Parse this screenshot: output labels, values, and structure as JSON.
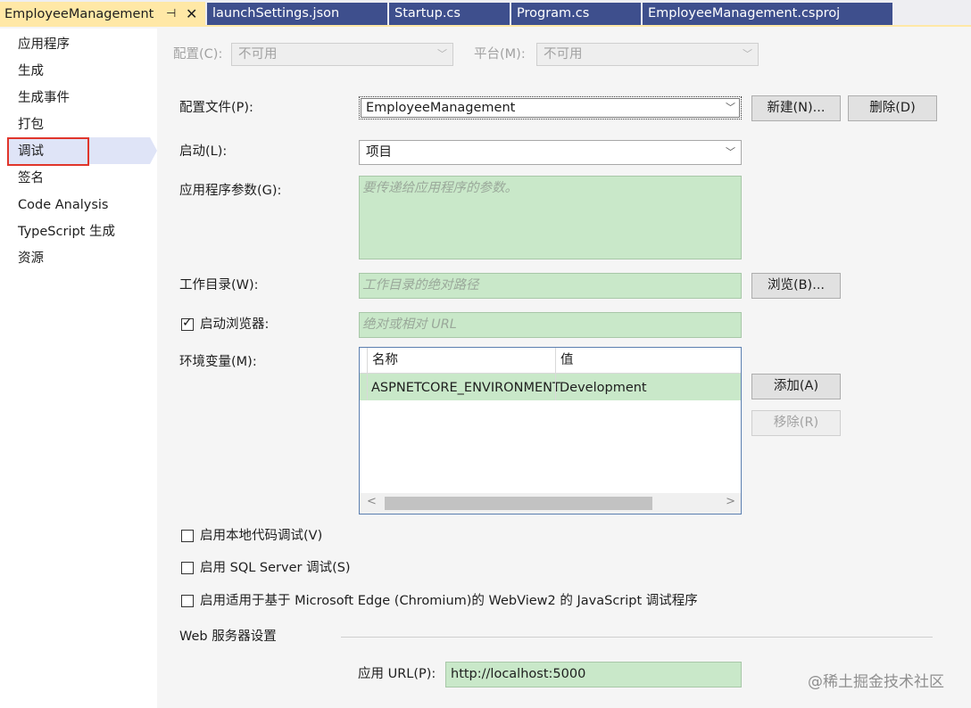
{
  "tabs": [
    {
      "label": "EmployeeManagement",
      "pin": "⊣",
      "close": "✕"
    },
    {
      "label": "launchSettings.json"
    },
    {
      "label": "Startup.cs"
    },
    {
      "label": "Program.cs"
    },
    {
      "label": "EmployeeManagement.csproj"
    }
  ],
  "sidebar": {
    "items": [
      "应用程序",
      "生成",
      "生成事件",
      "打包",
      "调试",
      "签名",
      "Code Analysis",
      "TypeScript 生成",
      "资源"
    ],
    "selected": "调试"
  },
  "config": {
    "label": "配置(C):",
    "value": "不可用"
  },
  "platform": {
    "label": "平台(M):",
    "value": "不可用"
  },
  "profile": {
    "label": "配置文件(P):",
    "value": "EmployeeManagement",
    "new_btn": "新建(N)...",
    "delete_btn": "删除(D)"
  },
  "launch": {
    "label": "启动(L):",
    "value": "项目"
  },
  "app_args": {
    "label": "应用程序参数(G):",
    "placeholder": "要传递给应用程序的参数。"
  },
  "work_dir": {
    "label": "工作目录(W):",
    "placeholder": "工作目录的绝对路径",
    "browse_btn": "浏览(B)..."
  },
  "launch_browser": {
    "label": "启动浏览器:",
    "checked": true,
    "placeholder": "绝对或相对 URL"
  },
  "env": {
    "label": "环境变量(M):",
    "columns": [
      "名称",
      "值"
    ],
    "rows": [
      {
        "name": "ASPNETCORE_ENVIRONMENT",
        "value": "Development"
      }
    ],
    "add_btn": "添加(A)",
    "remove_btn": "移除(R)"
  },
  "options": [
    {
      "label": "启用本地代码调试(V)",
      "checked": false
    },
    {
      "label": "启用 SQL Server 调试(S)",
      "checked": false
    },
    {
      "label": "启用适用于基于 Microsoft Edge (Chromium)的 WebView2 的 JavaScript 调试程序",
      "checked": false
    }
  ],
  "web_server": {
    "title": "Web 服务器设置",
    "app_url_label": "应用 URL(P):",
    "app_url": "http://localhost:5000"
  },
  "watermark": "@稀土掘金技术社区",
  "icons": {
    "dropdown": "chevron-down-icon",
    "check": "check-icon"
  },
  "colors": {
    "tab_active": "#ffe8a6",
    "tab_inactive": "#3e4f8d",
    "field_green": "#c9e8c9",
    "highlight_red": "#e0352b"
  }
}
